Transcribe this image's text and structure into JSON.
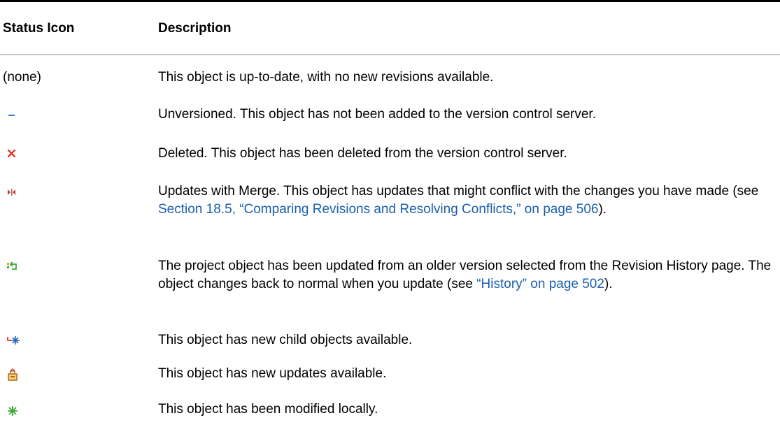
{
  "table": {
    "headers": {
      "status_icon": "Status Icon",
      "description": "Description"
    },
    "rows": [
      {
        "icon": "none",
        "icon_text": "(none)",
        "description": "This object is up-to-date, with no new revisions available."
      },
      {
        "icon": "unversioned-dash-icon",
        "icon_color": "#3a7bd5",
        "description": "Unversioned. This object has not been added to the version control server."
      },
      {
        "icon": "deleted-x-icon",
        "icon_color": "#e2231a",
        "description": "Deleted. This object has been deleted from the version control server."
      },
      {
        "icon": "merge-icon",
        "icon_color": "#d8342b",
        "description_before": "Updates with Merge. This object has updates that might conflict with the changes you have made (see ",
        "link_text": "Section 18.5, “Comparing Revisions and Resolving Conflicts,” on page 506",
        "description_after": ")."
      },
      {
        "icon": "reverted-history-icon",
        "icon_color": "#3aa935",
        "description_before": "The project object has been updated from an older version selected from the Revision History page. The object changes back to normal when you update (see ",
        "link_text": "“History” on page 502",
        "description_after": ")."
      },
      {
        "icon": "new-child-objects-icon",
        "icon_color": "#2b67b5",
        "description": "This object has new child objects available."
      },
      {
        "icon": "new-updates-icon",
        "icon_color": "#d99a2b",
        "description": "This object has new updates available."
      },
      {
        "icon": "modified-locally-icon",
        "icon_color": "#3aa935",
        "description": "This object has been modified locally."
      }
    ]
  }
}
